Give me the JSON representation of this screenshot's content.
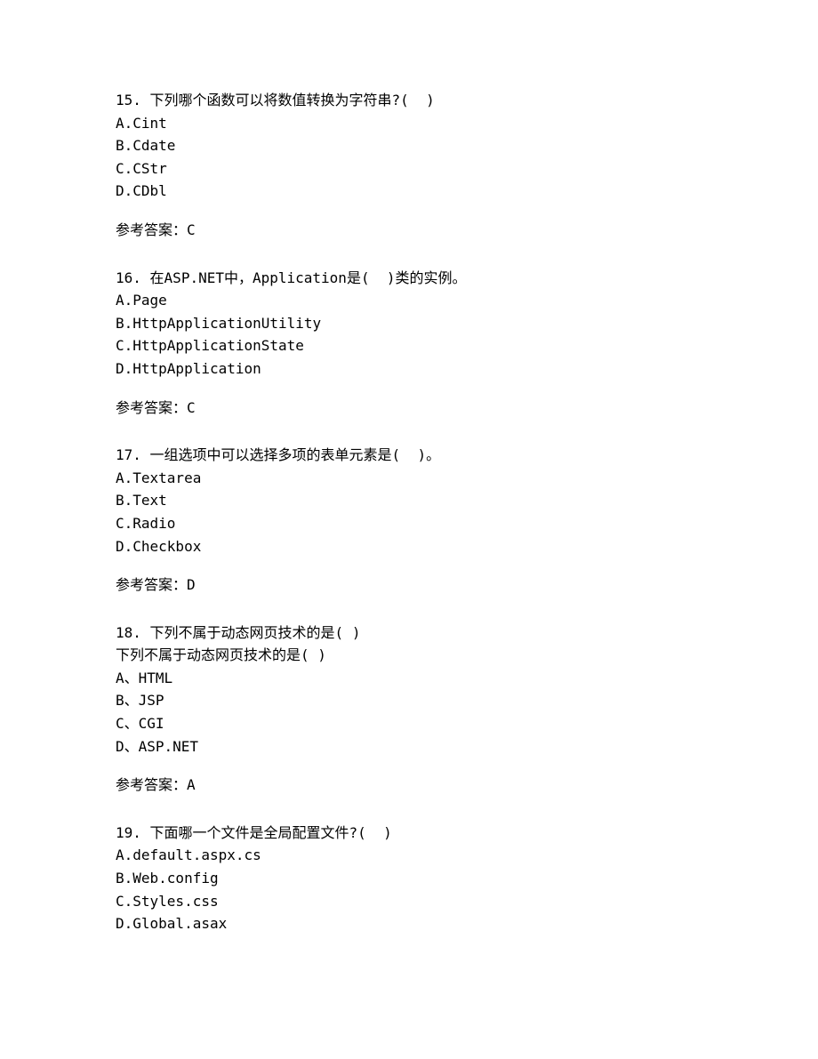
{
  "questions": [
    {
      "number": "15.",
      "text": "下列哪个函数可以将数值转换为字符串?(  )",
      "options": [
        "A.Cint",
        "B.Cdate",
        "C.CStr",
        "D.CDbl"
      ],
      "answer_label": "参考答案：",
      "answer": "C"
    },
    {
      "number": "16.",
      "text": "在ASP.NET中，Application是(  )类的实例。",
      "options": [
        "A.Page",
        "B.HttpApplicationUtility",
        "C.HttpApplicationState",
        "D.HttpApplication"
      ],
      "answer_label": "参考答案：",
      "answer": "C"
    },
    {
      "number": "17.",
      "text": "一组选项中可以选择多项的表单元素是(  )。",
      "options": [
        "A.Textarea",
        "B.Text",
        "C.Radio",
        "D.Checkbox"
      ],
      "answer_label": "参考答案：",
      "answer": "D"
    },
    {
      "number": "18.",
      "text": "下列不属于动态网页技术的是( )",
      "extra_lines": [
        "下列不属于动态网页技术的是( )"
      ],
      "options": [
        "A、HTML",
        "B、JSP",
        "C、CGI",
        "D、ASP.NET"
      ],
      "answer_label": "参考答案：",
      "answer": "A"
    },
    {
      "number": "19.",
      "text": "下面哪一个文件是全局配置文件?(  )",
      "options": [
        "A.default.aspx.cs",
        "B.Web.config",
        "C.Styles.css",
        "D.Global.asax"
      ],
      "answer_label": "",
      "answer": ""
    }
  ]
}
